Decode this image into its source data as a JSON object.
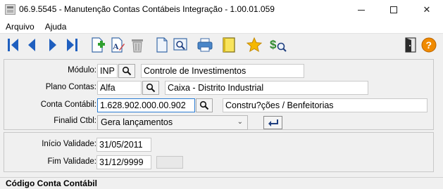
{
  "window": {
    "title": "06.9.5545 - Manutenção Contas Contábeis Integração - 1.00.01.059",
    "minimize": "—",
    "maximize": "☐",
    "close": "✕"
  },
  "menu": {
    "items": [
      {
        "label": "Arquivo"
      },
      {
        "label": "Ajuda"
      }
    ]
  },
  "toolbar": {
    "buttons": [
      {
        "name": "first-record-icon"
      },
      {
        "name": "previous-record-icon"
      },
      {
        "name": "next-record-icon"
      },
      {
        "name": "last-record-icon"
      },
      {
        "name": "add-record-icon"
      },
      {
        "name": "edit-record-icon"
      },
      {
        "name": "delete-record-icon"
      },
      {
        "name": "copy-record-icon"
      },
      {
        "name": "search-record-icon"
      },
      {
        "name": "print-icon"
      },
      {
        "name": "notes-icon"
      },
      {
        "name": "favorite-star-icon"
      },
      {
        "name": "finance-query-icon"
      },
      {
        "name": "exit-door-icon"
      },
      {
        "name": "help-icon"
      }
    ],
    "colors": {
      "nav_blue": "#1f5fbf",
      "star": "#f5b800",
      "help": "#f08a00",
      "dollar": "#2f8a2f"
    }
  },
  "form": {
    "modulo": {
      "label": "Módulo:",
      "code": "INP",
      "description": "Controle de Investimentos"
    },
    "plano": {
      "label": "Plano Contas:",
      "code": "Alfa",
      "description": "Caixa - Distrito Industrial"
    },
    "conta": {
      "label": "Conta Contábil:",
      "code": "1.628.902.000.00.902",
      "description": "Constru?ções / Benfeitorias"
    },
    "finalidade": {
      "label": "Finalid Ctbl:",
      "value": "Gera lançamentos"
    },
    "inicio": {
      "label": "Início Validade:",
      "value": "31/05/2011"
    },
    "fim": {
      "label": "Fim Validade:",
      "value": "31/12/9999"
    }
  },
  "status": {
    "text": "Código Conta Contábil"
  }
}
